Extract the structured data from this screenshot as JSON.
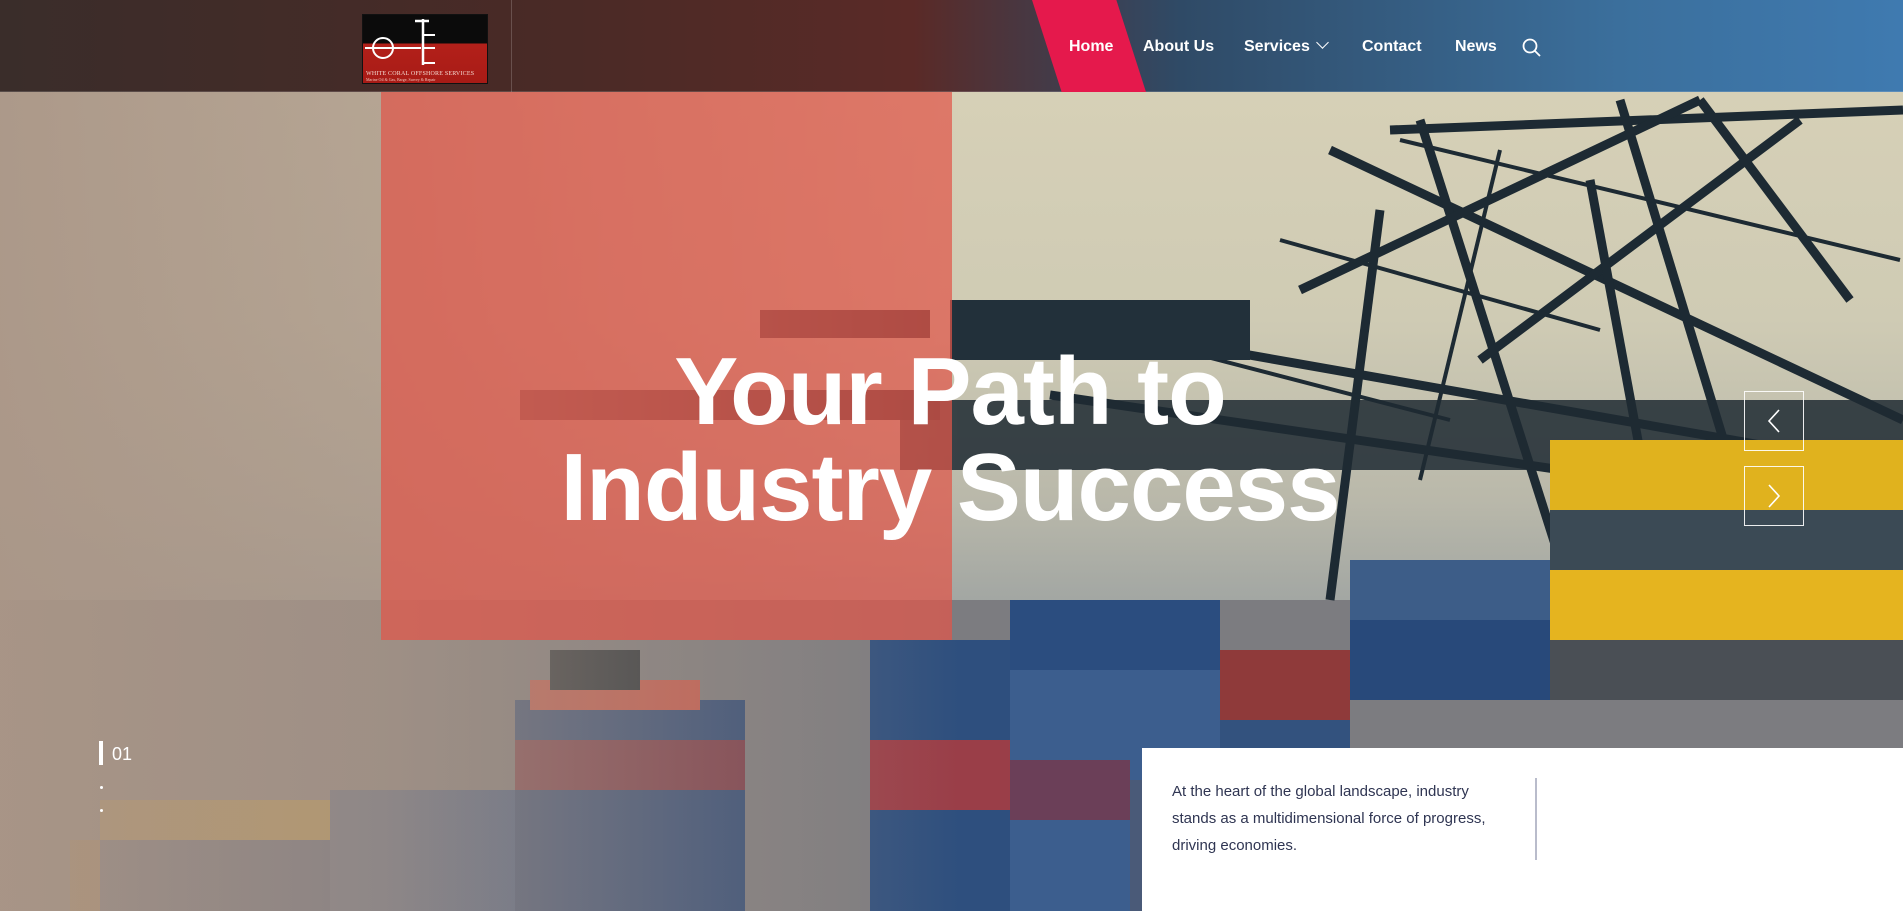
{
  "header": {
    "logo": {
      "tagline": "WHITE CORAL OFFSHORE SERVICES",
      "subline": "Marine Oil & Gas, Barge, Survey & Repair"
    },
    "nav": [
      {
        "label": "Home",
        "active": true
      },
      {
        "label": "About Us"
      },
      {
        "label": "Services",
        "has_dropdown": true
      },
      {
        "label": "Contact"
      },
      {
        "label": "News"
      }
    ],
    "search_icon": "search-icon"
  },
  "hero": {
    "title_line1": "Your Path to",
    "title_line2": "Industry Success",
    "slide_number": "01",
    "prev_icon": "chevron-left-icon",
    "next_icon": "chevron-right-icon"
  },
  "info": {
    "text": "At the heart of the global landscape, industry stands as a multidimensional force of progress, driving economies."
  },
  "colors": {
    "accent": "#e5194c",
    "overlay": "#e1564a",
    "text_dark": "#2f3552"
  }
}
